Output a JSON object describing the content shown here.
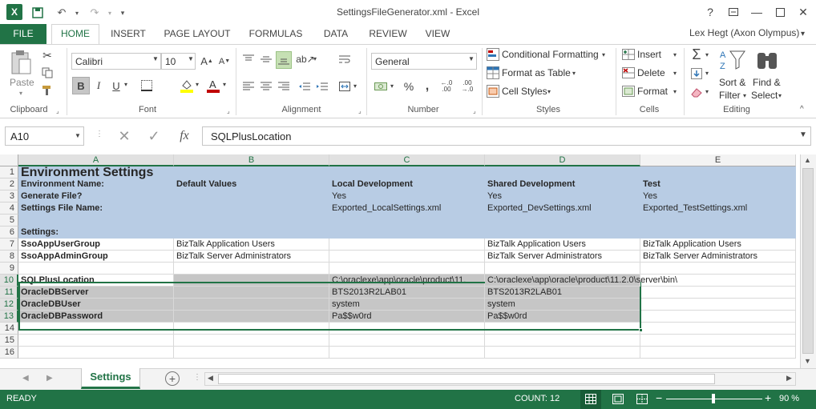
{
  "window": {
    "title": "SettingsFileGenerator.xml - Excel",
    "user": "Lex Hegt (Axon Olympus)"
  },
  "ribbon_tabs": [
    "FILE",
    "HOME",
    "INSERT",
    "PAGE LAYOUT",
    "FORMULAS",
    "DATA",
    "REVIEW",
    "VIEW"
  ],
  "ribbon": {
    "clipboard": {
      "paste": "Paste",
      "label": "Clipboard"
    },
    "font": {
      "name": "Calibri",
      "size": "10",
      "bold": "B",
      "italic": "I",
      "underline": "U",
      "label": "Font"
    },
    "alignment": {
      "label": "Alignment"
    },
    "number": {
      "format": "General",
      "label": "Number",
      "currency": "$",
      "percent": "%",
      "comma": ","
    },
    "styles": {
      "conditional": "Conditional Formatting",
      "table": "Format as Table",
      "cell": "Cell Styles",
      "label": "Styles"
    },
    "cells": {
      "insert": "Insert",
      "delete": "Delete",
      "format": "Format",
      "label": "Cells"
    },
    "editing": {
      "sort1": "Sort &",
      "sort2": "Filter",
      "find1": "Find &",
      "find2": "Select",
      "label": "Editing"
    }
  },
  "formula_bar": {
    "name_box": "A10",
    "fx": "fx",
    "formula": "SQLPlusLocation"
  },
  "columns": [
    "A",
    "B",
    "C",
    "D",
    "E"
  ],
  "rows": [
    {
      "n": "1",
      "a": "Environment Settings",
      "b": "",
      "c": "",
      "d": "",
      "e": ""
    },
    {
      "n": "2",
      "a": "Environment Name:",
      "b": "Default Values",
      "c": "Local Development",
      "d": "Shared Development",
      "e": "Test"
    },
    {
      "n": "3",
      "a": "Generate File?",
      "b": "",
      "c": "Yes",
      "d": "Yes",
      "e": "Yes"
    },
    {
      "n": "4",
      "a": "Settings File Name:",
      "b": "",
      "c": "Exported_LocalSettings.xml",
      "d": "Exported_DevSettings.xml",
      "e": "Exported_TestSettings.xml"
    },
    {
      "n": "5",
      "a": "",
      "b": "",
      "c": "",
      "d": "",
      "e": ""
    },
    {
      "n": "6",
      "a": "Settings:",
      "b": "",
      "c": "",
      "d": "",
      "e": ""
    },
    {
      "n": "7",
      "a": "SsoAppUserGroup",
      "b": "BizTalk Application Users",
      "c": "",
      "d": "BizTalk Application Users",
      "e": "BizTalk Application Users"
    },
    {
      "n": "8",
      "a": "SsoAppAdminGroup",
      "b": "BizTalk Server Administrators",
      "c": "",
      "d": "BizTalk Server Administrators",
      "e": "BizTalk Server Administrators"
    },
    {
      "n": "9",
      "a": "",
      "b": "",
      "c": "",
      "d": "",
      "e": ""
    },
    {
      "n": "10",
      "a": "SQLPlusLocation",
      "b": "",
      "c": "C:\\oraclexe\\app\\oracle\\product\\11.",
      "d": "C:\\oraclexe\\app\\oracle\\product\\11.2.0\\server\\bin\\",
      "e": ""
    },
    {
      "n": "11",
      "a": "OracleDBServer",
      "b": "",
      "c": "BTS2013R2LAB01",
      "d": "BTS2013R2LAB01",
      "e": ""
    },
    {
      "n": "12",
      "a": "OracleDBUser",
      "b": "",
      "c": "system",
      "d": "system",
      "e": ""
    },
    {
      "n": "13",
      "a": "OracleDBPassword",
      "b": "",
      "c": "Pa$$w0rd",
      "d": "Pa$$w0rd",
      "e": ""
    },
    {
      "n": "14",
      "a": "",
      "b": "",
      "c": "",
      "d": "",
      "e": ""
    },
    {
      "n": "15",
      "a": "",
      "b": "",
      "c": "",
      "d": "",
      "e": ""
    },
    {
      "n": "16",
      "a": "",
      "b": "",
      "c": "",
      "d": "",
      "e": ""
    }
  ],
  "sheet_tab": "Settings",
  "status": {
    "ready": "READY",
    "count": "COUNT: 12",
    "zoom": "90 %"
  },
  "colors": {
    "accent": "#217346",
    "header_fill": "#b8cce4",
    "selection_fill": "#c6c6c6"
  }
}
